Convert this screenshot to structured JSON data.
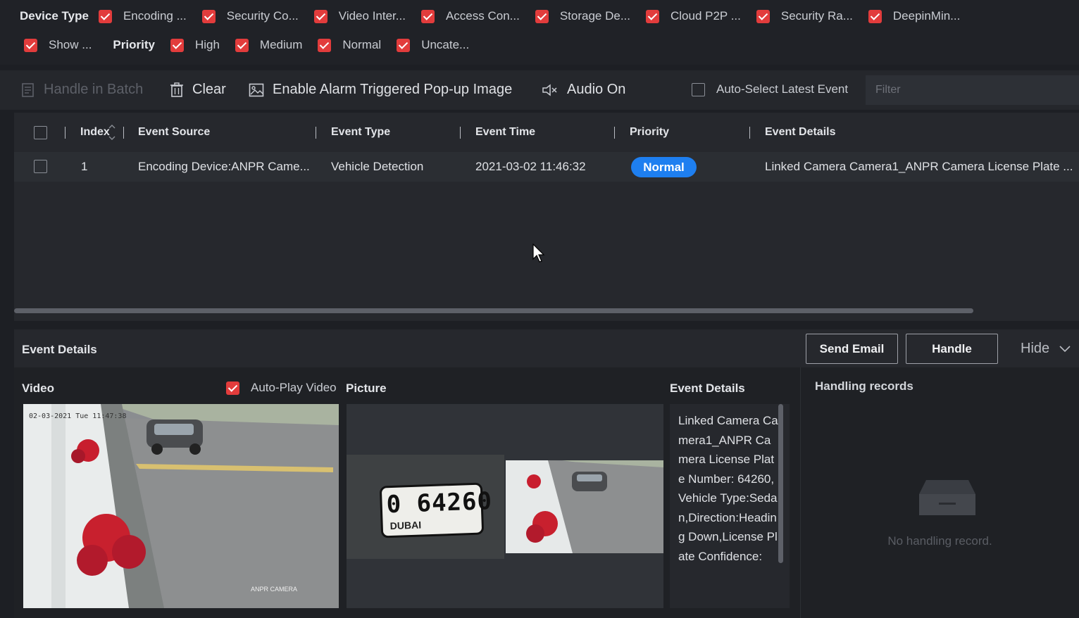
{
  "filters": {
    "device_type_label": "Device Type",
    "device_types": [
      "Encoding ...",
      "Security Co...",
      "Video Inter...",
      "Access Con...",
      "Storage De...",
      "Cloud P2P ...",
      "Security Ra...",
      "DeepinMin...",
      "Show ..."
    ],
    "priority_label": "Priority",
    "priorities": [
      "High",
      "Medium",
      "Normal",
      "Uncate..."
    ],
    "check_color": "#e23c3c"
  },
  "toolbar": {
    "handle_in_batch": "Handle in Batch",
    "clear": "Clear",
    "enable_popup": "Enable Alarm Triggered Pop-up Image",
    "audio_on": "Audio On",
    "auto_select": "Auto-Select Latest Event",
    "filter_placeholder": "Filter"
  },
  "table": {
    "columns": [
      "Index",
      "Event Source",
      "Event Type",
      "Event Time",
      "Priority",
      "Event Details"
    ],
    "rows": [
      {
        "index": "1",
        "source": "Encoding Device:ANPR Came...",
        "type": "Vehicle Detection",
        "time": "2021-03-02 11:46:32",
        "priority": "Normal",
        "details": "Linked Camera Camera1_ANPR Camera License Plate ..."
      }
    ],
    "priority_color": "#1e7ff0"
  },
  "details": {
    "title": "Event Details",
    "send_email": "Send Email",
    "handle": "Handle",
    "hide": "Hide",
    "video_label": "Video",
    "auto_play": "Auto-Play Video",
    "picture_label": "Picture",
    "event_details_label": "Event Details",
    "event_details_text": "Linked Camera Camera1_ANPR Camera License Plate Number: 64260,Vehicle Type:Sedan,Direction:Heading Down,License Plate Confidence:",
    "video_overlay": "02-03-2021 Tue 11:47:38",
    "video_caption": "ANPR CAMERA",
    "plate_number": "0 64260",
    "plate_city": "DUBAI",
    "handling_title": "Handling records",
    "no_record": "No handling record."
  }
}
